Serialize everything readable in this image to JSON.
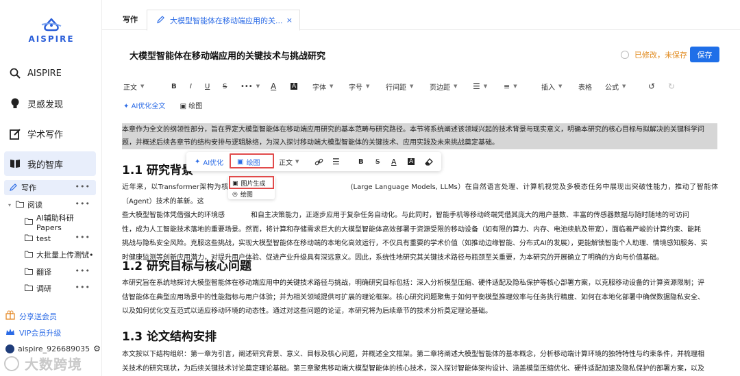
{
  "brand": {
    "name": "AISPIRE",
    "color": "#2b5fd9"
  },
  "sidebar": {
    "nav": [
      {
        "label": "AISPIRE",
        "icon": "search-icon"
      },
      {
        "label": "灵感发现",
        "icon": "bulb-icon"
      },
      {
        "label": "学术写作",
        "icon": "edit-icon"
      },
      {
        "label": "我的智库",
        "icon": "book-icon"
      }
    ],
    "tree": [
      {
        "label": "写作",
        "dots": "•••"
      },
      {
        "label": "阅读",
        "dots": "•••"
      },
      {
        "label": "AI辅助科研Papers",
        "dots": ""
      },
      {
        "label": "test",
        "dots": "•••"
      },
      {
        "label": "大批量上传测试•",
        "dots": "•••"
      },
      {
        "label": "翻译",
        "dots": "•••"
      },
      {
        "label": "调研",
        "dots": "•••"
      }
    ],
    "share": "分享送会员",
    "vip": "VIP会员升级",
    "user": "aispire_926689035",
    "watermark": "大数跨境"
  },
  "tabs": {
    "static": "写作",
    "active": "大模型智能体在移动端应用的关...",
    "close": "×"
  },
  "doc": {
    "title": "大模型智能体在移动端应用的关键技术与挑战研究",
    "status": "已修改，未保存",
    "save": "保存"
  },
  "toolbar": {
    "paragraph": "正文",
    "bold": "B",
    "italic": "I",
    "underline": "U",
    "strike": "S",
    "more": "•••",
    "font_color": "A",
    "bg_color": "A",
    "font": "字体",
    "size": "字号",
    "line_height": "行间距",
    "margin": "页边距",
    "insert": "插入",
    "table": "表格",
    "formula": "公式",
    "ai_optimize": "AI优化全文",
    "draw": "绘图"
  },
  "float_bar": {
    "ai": "AI优化",
    "draw": "绘图",
    "para": "正文",
    "bold": "B",
    "strike": "S",
    "color": "A",
    "bg": "A"
  },
  "sub_menu": {
    "image_gen": "图片生成",
    "draw": "绘图"
  },
  "content": {
    "intro_1": "本章作为全文的纲领性部分，旨在界定大模型智能体在移动端应用研究的基本范畴与研究路径。本节将系统阐述该领域兴起的技术背景与现实意义，明确本研究的核心目标与拟解决的关键科学问",
    "intro_2": "题，并概述后续各章节的结构安排与逻辑脉络，为深入探讨移动端大模型智能体的关键技术、应用实践及未来挑战奠定基础。",
    "h1": "1.1 研究背景",
    "p1_1": "近年来，以Transformer架构为核",
    "p1_1b": "(Large Language Models, LLMs）在自然语言处理、计算机视觉及多模态任务中展现出突破性能力，推动了智能体（Agent）技术的革新。这",
    "p1_2a": "些大模型智能体凭借强大的环境感",
    "p1_2b": "和自主决策能力，正逐步应用于复杂任务自动化。与此同时，智能手机等移动终端凭借其庞大的用户基数、丰富的传感器数据与随时随地的可访问",
    "p1_3": "性，成为人工智能技术落地的重要场景。然而，将计算和存储需求巨大的大模型智能体高效部署于资源受限的移动设备（如有限的算力、内存、电池续航及带宽），面临着严峻的计算约束、能耗",
    "p1_4": "挑战与隐私安全风险。克服这些挑战，实现大模型智能体在移动端的本地化高效运行，不仅具有重要的学术价值（如推动边缘智能、分布式AI的发展），更能解锁智能个人助理、情境感知服务、实",
    "p1_5": "时健康监测等创新应用潜力，对提升用户体验、促进产业升级具有深远意义。因此，系统性地研究其关键技术路径与瓶颈至关重要，为本研究的开展确立了明确的方向与价值基础。",
    "h2": "1.2 研究目标与核心问题",
    "p2_1": "本研究旨在系统地探讨大模型智能体在移动端应用中的关键技术路径与挑战，明确研究目标包括：深入分析模型压缩、硬件适配及隐私保护等核心部署方案，以克服移动设备的计算资源限制；评",
    "p2_2": "估智能体在典型应用场景中的性能指标与用户体验；并为相关领域提供可扩展的理论框架。核心研究问题聚焦于如何平衡模型推理效率与任务执行精度、如何在本地化部署中确保数据隐私安全、",
    "p2_3": "以及如何优化交互范式以适应移动环境的动态性。通过对这些问题的论证，本研究将为后续章节的技术分析奠定理论基础。",
    "h3": "1.3 论文结构安排",
    "p3_1": "本文按以下结构组织：第一章为引言，阐述研究背景、意义、目标及核心问题，并概述全文框架。第二章将阐述大模型智能体的基本概念，分析移动端计算环境的独特特性与约束条件，并梳理相",
    "p3_2": "关技术的研究现状，为后续关键技术讨论奠定理论基础。第三章聚焦移动端大模型智能体的核心技术，深入探讨智能体架构设计、涵盖模型压缩优化、硬件适配加速及隐私保护的部署方案，以及"
  }
}
